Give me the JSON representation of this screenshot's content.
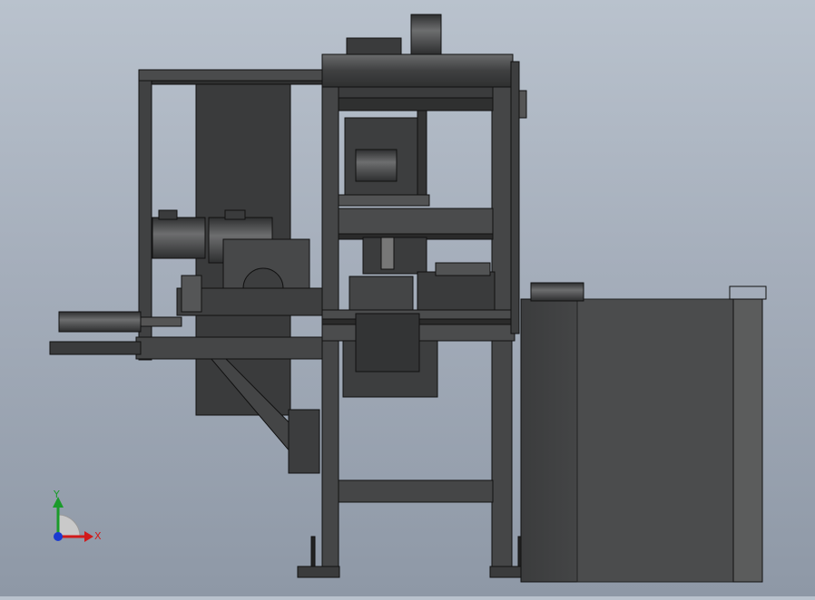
{
  "viewport": {
    "background_top": "#b9c2cd",
    "background_bottom": "#8e98a6",
    "model_dark": "#3a3b3c",
    "model_mid": "#555657",
    "edge_color": "#111111"
  },
  "triad": {
    "x_label": "X",
    "y_label": "Y",
    "x_color": "#d11a1a",
    "y_color": "#1a9b2a",
    "z_color": "#1a3ad1"
  }
}
